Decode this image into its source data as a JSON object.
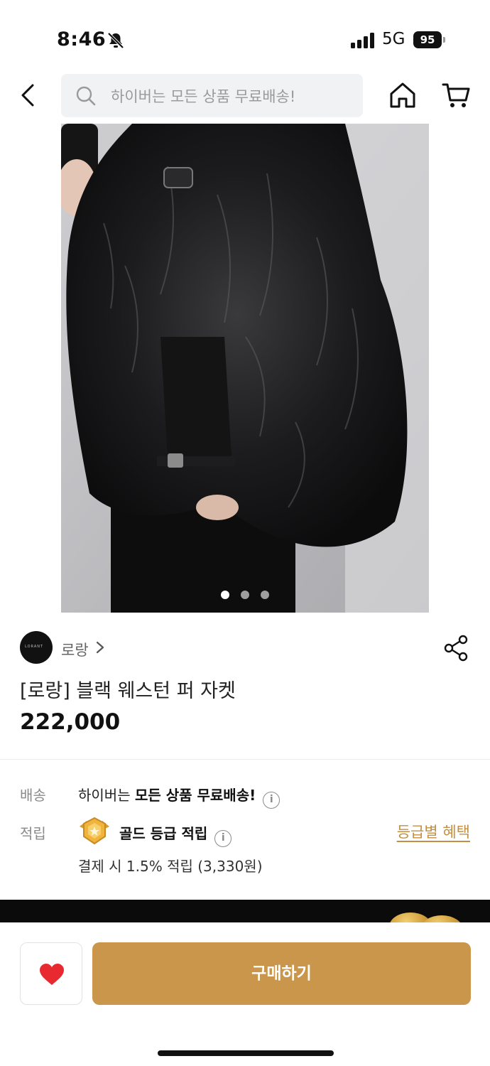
{
  "status_bar": {
    "time": "8:46",
    "network": "5G",
    "battery": "95"
  },
  "search": {
    "placeholder": "하이버는 모든 상품 무료배송!"
  },
  "product": {
    "image_count": 3,
    "active_image_index": 0,
    "brand_name": "로랑",
    "brand_logo_text": "LORANT",
    "title": "[로랑] 블랙 웨스턴 퍼 자켓",
    "price": "222,000"
  },
  "shipping": {
    "label": "배송",
    "prefix": "하이버는 ",
    "highlight": "모든 상품 무료배송!"
  },
  "points": {
    "label": "적립",
    "grade_text": "골드 등급 적립",
    "grade_link": "등급별 혜택",
    "detail": "결제 시 1.5% 적립 (3,330원)"
  },
  "info_icon_glyph": "i",
  "bottom_bar": {
    "buy_label": "구매하기"
  },
  "colors": {
    "accent": "#c9964b",
    "link": "#c38f43",
    "heart": "#e8292f"
  }
}
